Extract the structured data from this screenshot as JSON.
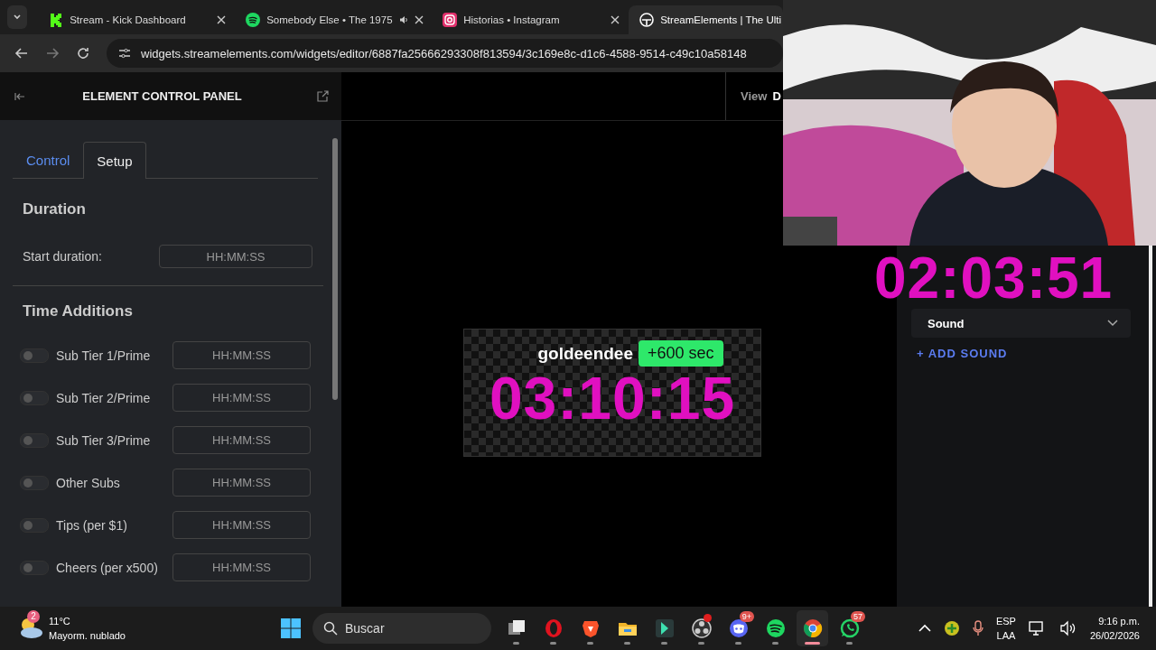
{
  "browser": {
    "tabs": [
      {
        "kind": "kick",
        "title": "Stream - Kick Dashboard",
        "audio": false,
        "selected": false
      },
      {
        "kind": "spotify",
        "title": "Somebody Else • The 1975",
        "audio": true,
        "selected": false
      },
      {
        "kind": "instagram",
        "title": "Historias • Instagram",
        "audio": false,
        "selected": false
      },
      {
        "kind": "streamelements",
        "title": "StreamElements | The Ulti",
        "audio": false,
        "selected": true
      }
    ],
    "url": "widgets.streamelements.com/widgets/editor/6887fa25666293308f813594/3c169e8c-d1c6-4588-9514-c49c10a58148"
  },
  "panel": {
    "title": "ELEMENT CONTROL PANEL",
    "tabs": [
      {
        "label": "Control",
        "selected": false
      },
      {
        "label": "Setup",
        "selected": true
      }
    ],
    "duration_title": "Duration",
    "start_duration": {
      "label": "Start duration:",
      "placeholder": "HH:MM:SS"
    },
    "additions_title": "Time Additions",
    "rows": [
      {
        "label": "Sub Tier 1/Prime",
        "on": false,
        "placeholder": "HH:MM:SS"
      },
      {
        "label": "Sub Tier 2/Prime",
        "on": false,
        "placeholder": "HH:MM:SS"
      },
      {
        "label": "Sub Tier 3/Prime",
        "on": false,
        "placeholder": "HH:MM:SS"
      },
      {
        "label": "Other Subs",
        "on": false,
        "placeholder": "HH:MM:SS"
      },
      {
        "label": "Tips (per $1)",
        "on": false,
        "placeholder": "HH:MM:SS"
      },
      {
        "label": "Cheers (per x500)",
        "on": false,
        "placeholder": "HH:MM:SS"
      }
    ]
  },
  "canvas": {
    "view_label": "View",
    "view_value": "D",
    "widget": {
      "user": "goldeendee",
      "badge": "+600 sec",
      "timer": "03:10:15"
    }
  },
  "right_panel": {
    "sound_label": "Sound",
    "add_sound": "+ ADD SOUND"
  },
  "overlay_timer": "02:03:51",
  "taskbar": {
    "weather": {
      "badge": "2",
      "temp": "11°C",
      "desc": "Mayorm. nublado"
    },
    "search_placeholder": "Buscar",
    "apps": [
      {
        "kind": "taskview",
        "selected": false
      },
      {
        "kind": "opera",
        "selected": false
      },
      {
        "kind": "brave",
        "selected": false
      },
      {
        "kind": "files",
        "selected": false
      },
      {
        "kind": "filmora",
        "selected": false
      },
      {
        "kind": "obs",
        "dot": true,
        "selected": false
      },
      {
        "kind": "discord",
        "badge": "9+",
        "selected": false
      },
      {
        "kind": "spotify",
        "selected": false
      },
      {
        "kind": "chrome",
        "selected": true
      },
      {
        "kind": "whatsapp",
        "badge": "57",
        "selected": false
      }
    ],
    "lang": "ESP",
    "region": "LAA",
    "time": "9:16 p.m.",
    "date": "26/02/2026"
  }
}
